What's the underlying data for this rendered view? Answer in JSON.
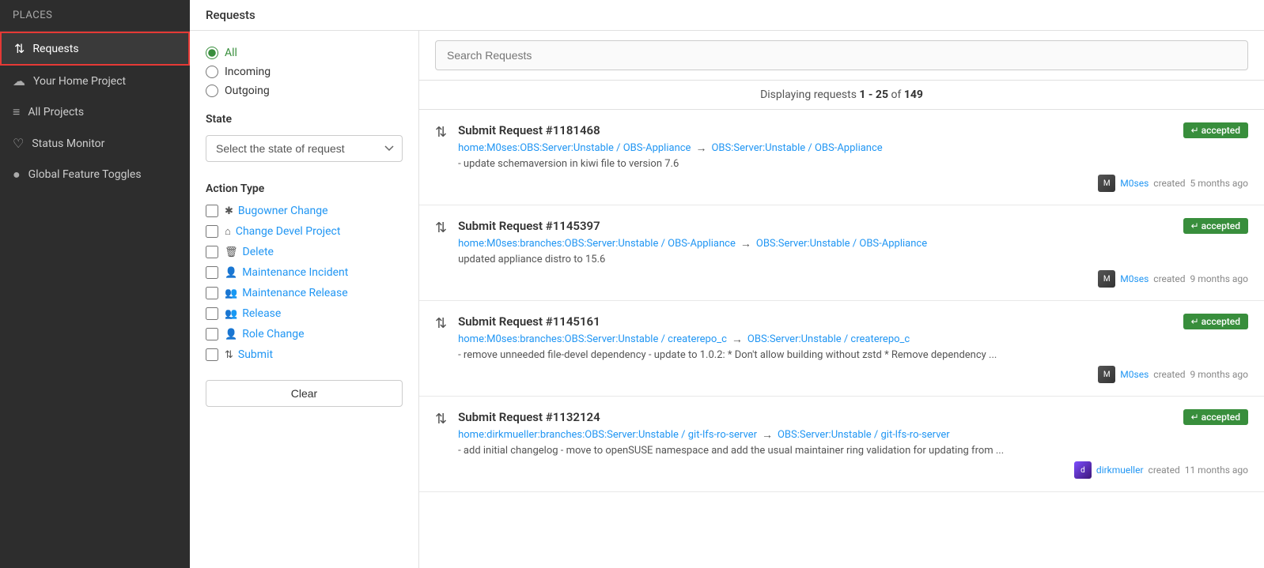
{
  "sidebar": {
    "header": "Places",
    "items": [
      {
        "id": "requests",
        "label": "Requests",
        "icon": "⇅",
        "active": true
      },
      {
        "id": "home-project",
        "label": "Your Home Project",
        "icon": "☁"
      },
      {
        "id": "all-projects",
        "label": "All Projects",
        "icon": "≡"
      },
      {
        "id": "status-monitor",
        "label": "Status Monitor",
        "icon": "♡"
      },
      {
        "id": "global-feature-toggles",
        "label": "Global Feature Toggles",
        "icon": "●"
      }
    ]
  },
  "main_header": "Requests",
  "filter": {
    "direction": {
      "options": [
        {
          "id": "all",
          "label": "All",
          "checked": true
        },
        {
          "id": "incoming",
          "label": "Incoming",
          "checked": false
        },
        {
          "id": "outgoing",
          "label": "Outgoing",
          "checked": false
        }
      ]
    },
    "state_section": "State",
    "state_placeholder": "Select the state of request",
    "action_type_section": "Action Type",
    "action_types": [
      {
        "id": "bugowner-change",
        "label": "Bugowner Change",
        "icon": "✱"
      },
      {
        "id": "change-devel-project",
        "label": "Change Devel Project",
        "icon": "⌂"
      },
      {
        "id": "delete",
        "label": "Delete",
        "icon": "🗑"
      },
      {
        "id": "maintenance-incident",
        "label": "Maintenance Incident",
        "icon": "👤"
      },
      {
        "id": "maintenance-release",
        "label": "Maintenance Release",
        "icon": "👥"
      },
      {
        "id": "release",
        "label": "Release",
        "icon": "👥"
      },
      {
        "id": "role-change",
        "label": "Role Change",
        "icon": "👤"
      },
      {
        "id": "submit",
        "label": "Submit",
        "icon": "⇅"
      }
    ],
    "clear_button": "Clear"
  },
  "search": {
    "placeholder": "Search Requests"
  },
  "display_info": {
    "prefix": "Displaying requests ",
    "range": "1 - 25",
    "of": "of",
    "total": "149"
  },
  "requests": [
    {
      "id": "1181468",
      "title": "Submit Request #1181468",
      "badge": "accepted",
      "source": "home:M0ses:OBS:Server:Unstable / OBS-Appliance",
      "target": "OBS:Server:Unstable / OBS-Appliance",
      "description": "- update schemaversion in kiwi file to version 7.6",
      "creator": "M0ses",
      "time_ago": "5 months ago"
    },
    {
      "id": "1145397",
      "title": "Submit Request #1145397",
      "badge": "accepted",
      "source": "home:M0ses:branches:OBS:Server:Unstable / OBS-Appliance",
      "target": "OBS:Server:Unstable / OBS-Appliance",
      "description": "updated appliance distro to 15.6",
      "creator": "M0ses",
      "time_ago": "9 months ago"
    },
    {
      "id": "1145161",
      "title": "Submit Request #1145161",
      "badge": "accepted",
      "source": "home:M0ses:branches:OBS:Server:Unstable / createrepo_c",
      "target": "OBS:Server:Unstable / createrepo_c",
      "description": "- remove unneeded file-devel dependency - update to 1.0.2: * Don't allow building without zstd * Remove dependency ...",
      "creator": "M0ses",
      "time_ago": "9 months ago"
    },
    {
      "id": "1132124",
      "title": "Submit Request #1132124",
      "badge": "accepted",
      "source": "home:dirkmueller:branches:OBS:Server:Unstable / git-lfs-ro-server",
      "target": "OBS:Server:Unstable / git-lfs-ro-server",
      "description": "- add initial changelog - move to openSUSE namespace and add the usual maintainer ring validation for updating from ...",
      "creator": "dirkmueller",
      "time_ago": "11 months ago"
    }
  ]
}
